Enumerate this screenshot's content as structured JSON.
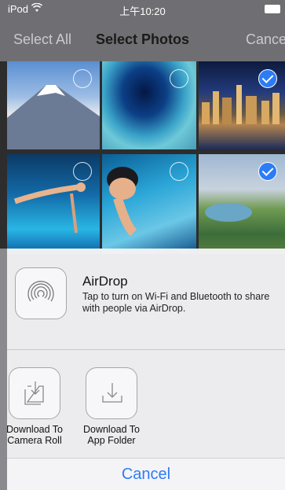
{
  "status_bar": {
    "carrier": "iPod",
    "wifi_icon": "wifi-icon",
    "time": "上午10:20",
    "battery_icon": "battery-icon"
  },
  "nav": {
    "left": "Select All",
    "title": "Select Photos",
    "right": "Cancel"
  },
  "photos": [
    {
      "name": "photo-mount-fuji",
      "selected": false
    },
    {
      "name": "photo-blue-hole",
      "selected": false
    },
    {
      "name": "photo-city-skyline",
      "selected": true
    },
    {
      "name": "photo-pool-dive",
      "selected": false
    },
    {
      "name": "photo-swimmer",
      "selected": false
    },
    {
      "name": "photo-green-hills",
      "selected": true
    }
  ],
  "airdrop": {
    "icon": "airdrop-icon",
    "title": "AirDrop",
    "description": "Tap to turn on Wi-Fi and Bluetooth to share with people via AirDrop."
  },
  "actions": [
    {
      "label_line1": "Download To",
      "label_line2": "Camera Roll",
      "icon": "download-camera-roll-icon"
    },
    {
      "label_line1": "Download To",
      "label_line2": "App Folder",
      "icon": "download-icon"
    }
  ],
  "cancel_label": "Cancel",
  "colors": {
    "accent": "#2f7cf6",
    "checkbox": "#2c7cf6"
  }
}
